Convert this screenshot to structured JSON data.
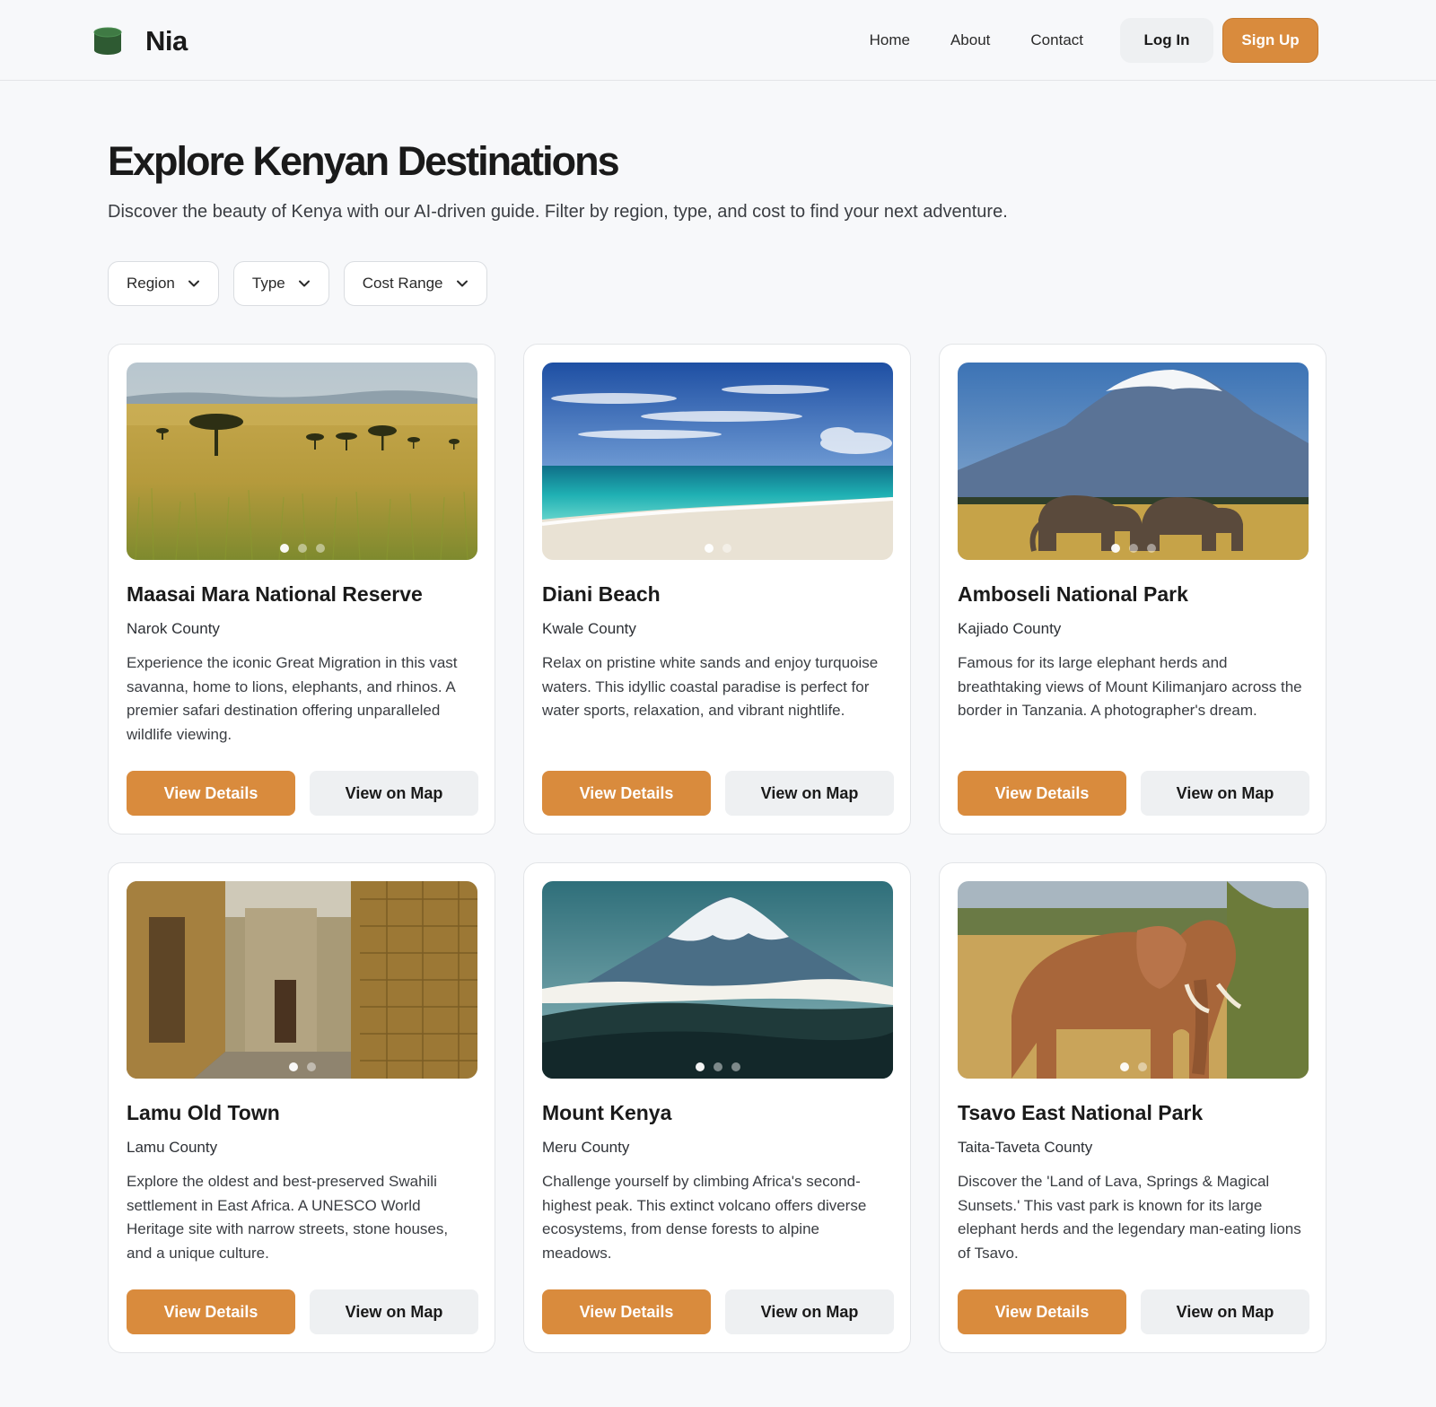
{
  "brand": {
    "name": "Nia",
    "logo_color": "#2e5a32"
  },
  "nav": {
    "links": [
      "Home",
      "About",
      "Contact"
    ],
    "login_label": "Log In",
    "signup_label": "Sign Up"
  },
  "colors": {
    "accent": "#d98b3d",
    "secondary_button": "#eef0f2",
    "background": "#f7f8fa"
  },
  "page": {
    "title": "Explore Kenyan Destinations",
    "subtitle": "Discover the beauty of Kenya with our AI-driven guide. Filter by region, type, and cost to find your next adventure."
  },
  "filters": [
    {
      "label": "Region",
      "icon": "chevron-down-icon"
    },
    {
      "label": "Type",
      "icon": "chevron-down-icon"
    },
    {
      "label": "Cost Range",
      "icon": "chevron-down-icon"
    }
  ],
  "destinations": [
    {
      "title": "Maasai Mara National Reserve",
      "county": "Narok County",
      "description": "Experience the iconic Great Migration in this vast savanna, home to lions, elephants, and rhinos. A premier safari destination offering unparalleled wildlife viewing.",
      "image": "savanna-acacia-photo",
      "carousel_total": 3,
      "carousel_active": 1,
      "details_label": "View Details",
      "map_label": "View on Map"
    },
    {
      "title": "Diani Beach",
      "county": "Kwale County",
      "description": "Relax on pristine white sands and enjoy turquoise waters. This idyllic coastal paradise is perfect for water sports, relaxation, and vibrant nightlife.",
      "image": "beach-ocean-photo",
      "carousel_total": 2,
      "carousel_active": 1,
      "details_label": "View Details",
      "map_label": "View on Map"
    },
    {
      "title": "Amboseli National Park",
      "county": "Kajiado County",
      "description": "Famous for its large elephant herds and breathtaking views of Mount Kilimanjaro across the border in Tanzania. A photographer's dream.",
      "image": "kilimanjaro-elephants-photo",
      "carousel_total": 3,
      "carousel_active": 1,
      "details_label": "View Details",
      "map_label": "View on Map"
    },
    {
      "title": "Lamu Old Town",
      "county": "Lamu County",
      "description": "Explore the oldest and best-preserved Swahili settlement in East Africa. A UNESCO World Heritage site with narrow streets, stone houses, and a unique culture.",
      "image": "stone-alley-photo",
      "carousel_total": 2,
      "carousel_active": 1,
      "details_label": "View Details",
      "map_label": "View on Map"
    },
    {
      "title": "Mount Kenya",
      "county": "Meru County",
      "description": "Challenge yourself by climbing Africa's second-highest peak. This extinct volcano offers diverse ecosystems, from dense forests to alpine meadows.",
      "image": "snow-mountain-photo",
      "carousel_total": 3,
      "carousel_active": 1,
      "details_label": "View Details",
      "map_label": "View on Map"
    },
    {
      "title": "Tsavo East National Park",
      "county": "Taita-Taveta County",
      "description": "Discover the 'Land of Lava, Springs & Magical Sunsets.' This vast park is known for its large elephant herds and the legendary man-eating lions of Tsavo.",
      "image": "elephant-bush-photo",
      "carousel_total": 2,
      "carousel_active": 1,
      "details_label": "View Details",
      "map_label": "View on Map"
    }
  ]
}
